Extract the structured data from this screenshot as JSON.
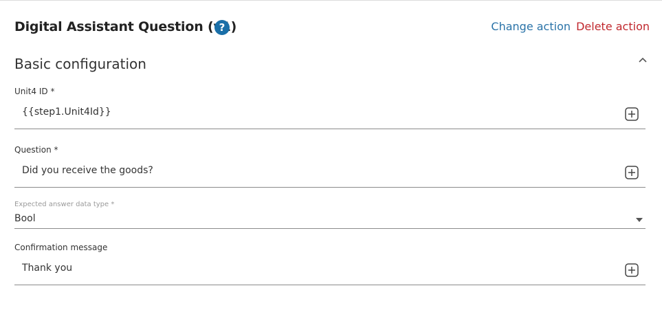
{
  "header": {
    "title": "Digital Assistant Question (v1)",
    "help_icon": "help-circle-icon",
    "help_glyph": "?",
    "change_action_label": "Change action",
    "delete_action_label": "Delete action"
  },
  "section": {
    "title": "Basic configuration",
    "toggle_icon": "chevron-up-icon"
  },
  "fields": [
    {
      "label": "Unit4 ID *",
      "value": "{{step1.Unit4Id}}",
      "icon": "plus-box-icon"
    },
    {
      "label": "Question *",
      "value": "Did you receive the goods?",
      "icon": "plus-box-icon"
    },
    {
      "label": "Expected answer data type *",
      "value": "Bool",
      "icon": "dropdown-caret-icon"
    },
    {
      "label": "Confirmation message",
      "value": "Thank you",
      "icon": "plus-box-icon"
    }
  ],
  "colors": {
    "link_blue": "#2a73a8",
    "delete_red": "#c0272d",
    "help_blue": "#1a6fa8"
  }
}
